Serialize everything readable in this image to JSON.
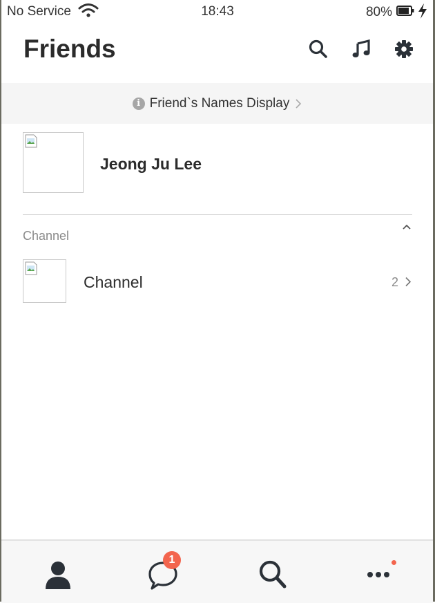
{
  "status_bar": {
    "carrier": "No Service",
    "time": "18:43",
    "battery": "80%"
  },
  "header": {
    "title": "Friends",
    "icons": [
      "search-icon",
      "music-icon",
      "gear-icon"
    ]
  },
  "banner": {
    "label": "Friend`s Names Display"
  },
  "profile": {
    "name": "Jeong Ju Lee"
  },
  "channel_section": {
    "label": "Channel",
    "items": [
      {
        "name": "Channel",
        "count": "2"
      }
    ]
  },
  "tab_bar": {
    "tabs": [
      "friends-tab",
      "chats-tab",
      "find-tab",
      "more-tab"
    ],
    "chats_badge": "1"
  },
  "colors": {
    "badge": "#f3654e",
    "icon": "#2b3138",
    "banner_bg": "#f5f5f5"
  }
}
